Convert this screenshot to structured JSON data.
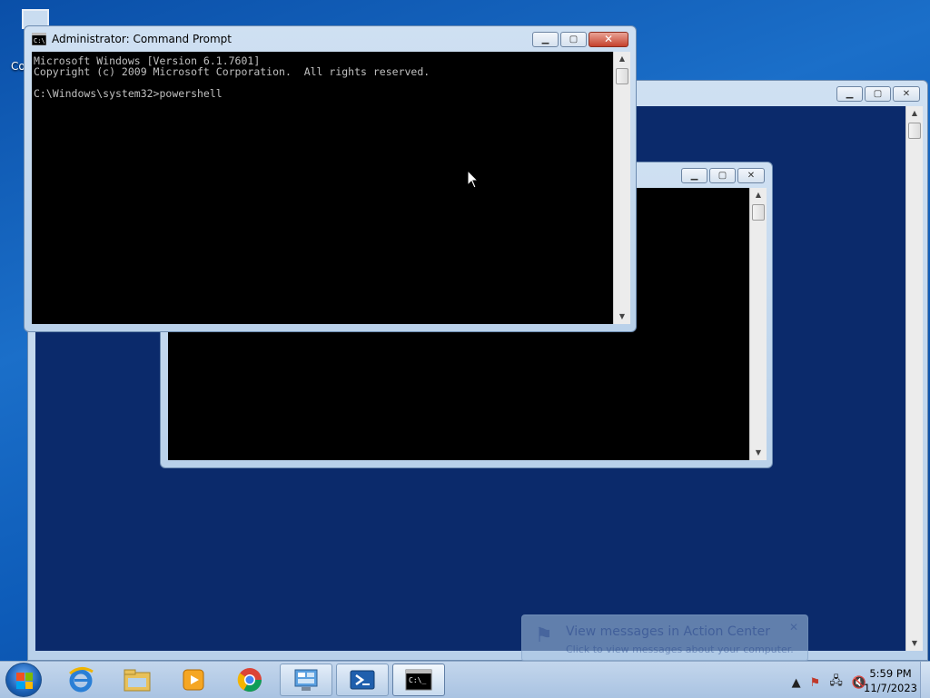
{
  "desktop": {
    "icon_label": "Co"
  },
  "main_window": {
    "title": "Administrator: Command Prompt",
    "lines": [
      "Microsoft Windows [Version 6.1.7601]",
      "Copyright (c) 2009 Microsoft Corporation.  All rights reserved.",
      "",
      "C:\\Windows\\system32>powershell"
    ]
  },
  "caption_buttons": {
    "minimize": "▁",
    "maximize": "▢",
    "close": "✕"
  },
  "taskbar": {
    "items": [
      "start",
      "internet-explorer",
      "windows-explorer",
      "media-player",
      "chrome",
      "control-panel",
      "powershell",
      "command-prompt"
    ],
    "clock_time": "5:59 PM",
    "clock_date": "11/7/2023"
  },
  "notification": {
    "title": "View messages in Action Center",
    "subtitle": "Click to view messages about your computer."
  },
  "colors": {
    "desktop_bg": "#1b6fc9",
    "console_bg": "#000000",
    "console_text": "#c0c0c0",
    "inner_window_bg": "#0b2a6b"
  }
}
